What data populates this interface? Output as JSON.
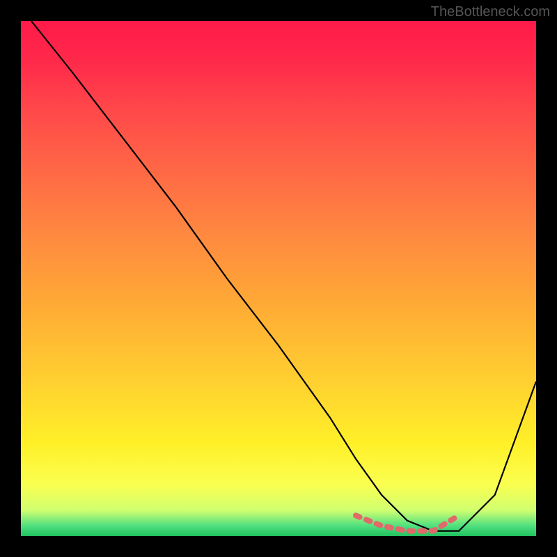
{
  "watermark": "TheBottleneck.com",
  "chart_data": {
    "type": "line",
    "title": "",
    "xlabel": "",
    "ylabel": "",
    "xlim": [
      0,
      100
    ],
    "ylim": [
      0,
      100
    ],
    "grid": false,
    "series": [
      {
        "name": "bottleneck-curve",
        "color": "#000000",
        "x": [
          2,
          10,
          20,
          30,
          40,
          50,
          60,
          65,
          70,
          75,
          80,
          85,
          92,
          100
        ],
        "values": [
          100,
          90,
          77,
          64,
          50,
          37,
          23,
          15,
          8,
          3,
          1,
          1,
          8,
          30
        ]
      },
      {
        "name": "optimal-range-marker",
        "color": "#e06a6a",
        "x": [
          65,
          70,
          75,
          80,
          85
        ],
        "values": [
          4,
          2,
          1,
          1,
          4
        ]
      }
    ],
    "gradient_stops": [
      {
        "pos": 0,
        "color": "#ff1a4a"
      },
      {
        "pos": 50,
        "color": "#ff9a38"
      },
      {
        "pos": 85,
        "color": "#fff028"
      },
      {
        "pos": 100,
        "color": "#20c060"
      }
    ]
  }
}
